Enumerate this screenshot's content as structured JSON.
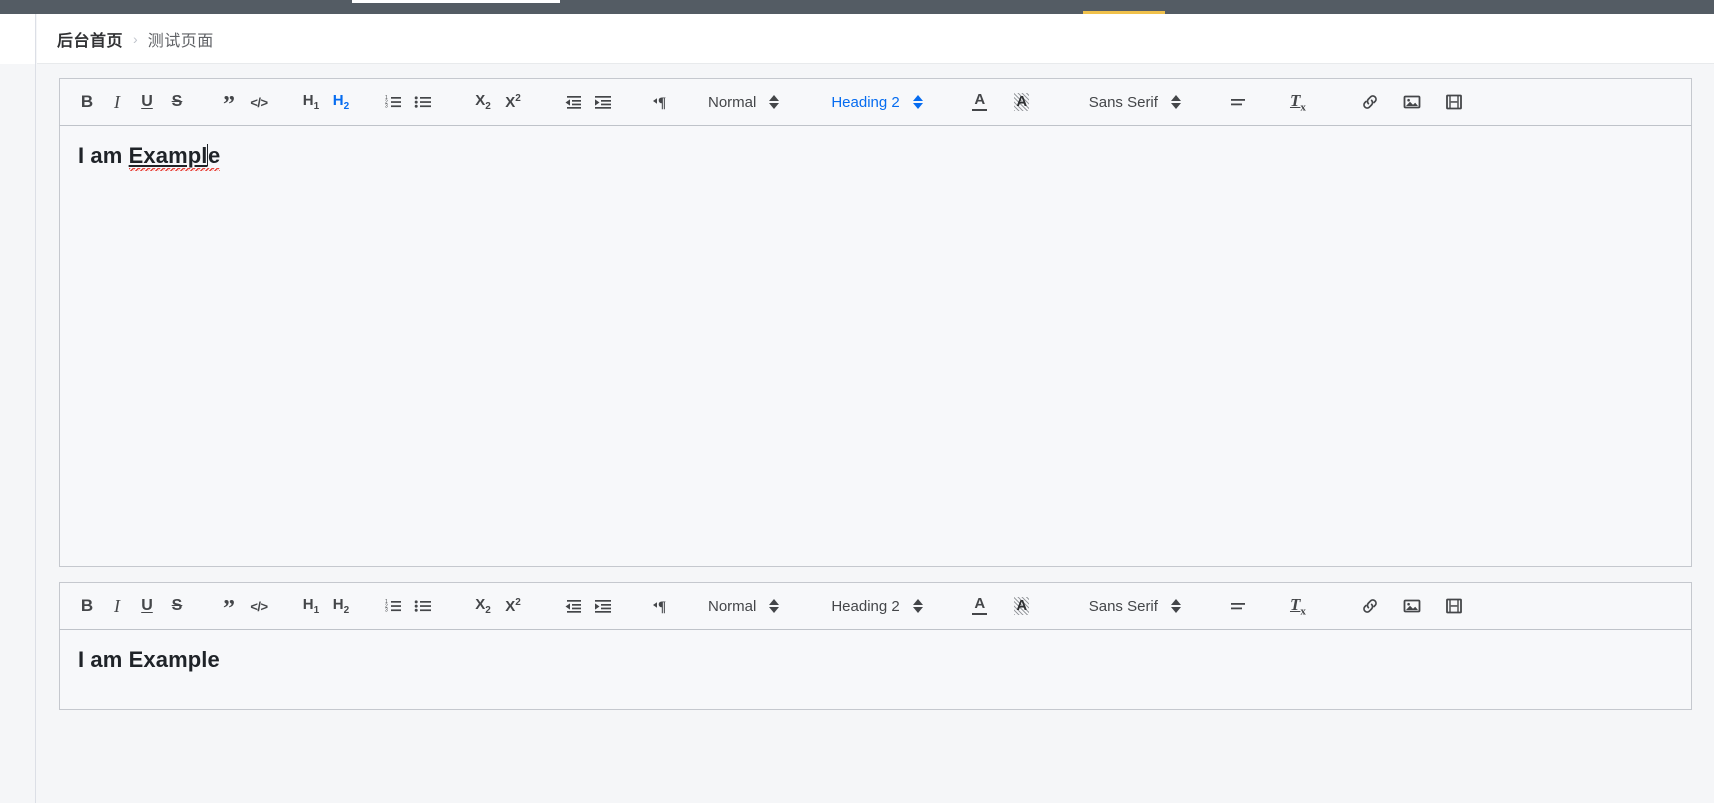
{
  "topbar": {
    "accent_color": "#f0c14b",
    "bar_color": "#545c64"
  },
  "breadcrumb": {
    "home_label": "后台首页",
    "separator": "›",
    "current_label": "测试页面"
  },
  "editors": [
    {
      "id": "editor-one",
      "active_heading_button": "H2",
      "heading_picker_active": true,
      "toolbar": {
        "bold": "B",
        "italic": "I",
        "underline": "U",
        "strike": "S",
        "blockquote": "”",
        "code_block": "</>",
        "header1": "H",
        "header1_sub": "1",
        "header2": "H",
        "header2_sub": "2",
        "ordered_list": "ordered-list-icon",
        "bullet_list": "bullet-list-icon",
        "subscript": "X",
        "subscript_sub": "2",
        "superscript": "X",
        "superscript_sup": "2",
        "outdent": "outdent-icon",
        "indent": "indent-icon",
        "direction": "¶",
        "size_picker": "Normal",
        "header_picker": "Heading 2",
        "color_picker": "A",
        "background_picker": "A",
        "font_picker": "Sans Serif",
        "align_picker": "align-icon",
        "clean": "T",
        "clean_sub": "x",
        "link": "link-icon",
        "image": "image-icon",
        "video": "video-icon"
      },
      "content": {
        "plain_prefix": "I am ",
        "underlined": "Exampl",
        "suffix": "e",
        "has_caret": true,
        "has_spellcheck_underline": true
      }
    },
    {
      "id": "editor-two",
      "active_heading_button": "",
      "heading_picker_active": false,
      "toolbar": {
        "bold": "B",
        "italic": "I",
        "underline": "U",
        "strike": "S",
        "blockquote": "”",
        "code_block": "</>",
        "header1": "H",
        "header1_sub": "1",
        "header2": "H",
        "header2_sub": "2",
        "ordered_list": "ordered-list-icon",
        "bullet_list": "bullet-list-icon",
        "subscript": "X",
        "subscript_sub": "2",
        "superscript": "X",
        "superscript_sup": "2",
        "outdent": "outdent-icon",
        "indent": "indent-icon",
        "direction": "¶",
        "size_picker": "Normal",
        "header_picker": "Heading 2",
        "color_picker": "A",
        "background_picker": "A",
        "font_picker": "Sans Serif",
        "align_picker": "align-icon",
        "clean": "T",
        "clean_sub": "x",
        "link": "link-icon",
        "image": "image-icon",
        "video": "video-icon"
      },
      "content": {
        "plain_prefix": "I am ",
        "underlined": "",
        "suffix": "Example",
        "has_caret": false,
        "has_spellcheck_underline": false
      }
    }
  ]
}
